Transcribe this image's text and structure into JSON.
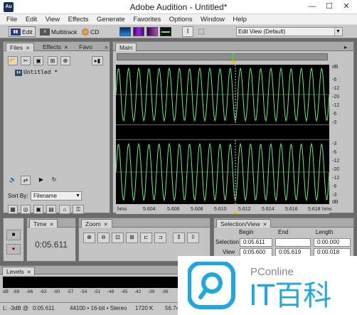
{
  "window": {
    "title": "Adobe Audition - Untitled*",
    "app_icon_label": "Au",
    "minimize": "—",
    "maximize": "☐",
    "close": "✕"
  },
  "menu": [
    "File",
    "Edit",
    "View",
    "Effects",
    "Generate",
    "Favorites",
    "Options",
    "Window",
    "Help"
  ],
  "toolbar": {
    "modes": [
      {
        "label": "Edit",
        "icon": "edit-view-icon"
      },
      {
        "label": "Multitrack",
        "icon": "multitrack-icon"
      },
      {
        "label": "CD",
        "icon": "cd-icon"
      }
    ],
    "view_select": "Edit View (Default)"
  },
  "files_panel": {
    "tabs": [
      "Files",
      "Effects",
      "Favo"
    ],
    "file_item": "Untitled *",
    "sort_label": "Sort By:",
    "sort_value": "Filename"
  },
  "main_panel": {
    "tab": "Main",
    "db_labels": [
      "dB",
      "-6",
      "-12",
      "-20",
      "-12",
      "-6",
      "-3"
    ],
    "db_labels_bottom": [
      "-3",
      "-6",
      "-12",
      "-20",
      "-12",
      "-6",
      "-3"
    ],
    "db_bottom_unit": "dB",
    "time_unit": "hms",
    "time_ticks": [
      "5.604",
      "5.606",
      "5.608",
      "5.610",
      "5.612",
      "5.614",
      "5.616",
      "5.618"
    ],
    "time_unit_end": "hms"
  },
  "time_panel": {
    "tab": "Time",
    "value": "0:05.611"
  },
  "zoom_panel": {
    "tab": "Zoom"
  },
  "selection_panel": {
    "tab": "Selection/View",
    "headers": [
      "Begin",
      "End",
      "Length"
    ],
    "rows": [
      {
        "label": "Selection",
        "begin": "0:05.611",
        "end": "",
        "length": "0:00.000"
      },
      {
        "label": "View",
        "begin": "0:05.600",
        "end": "0:05.619",
        "length": "0:00.018"
      }
    ]
  },
  "levels_panel": {
    "tab": "Levels",
    "scale": [
      "dB",
      "-69",
      "-66",
      "-63",
      "-60",
      "-57",
      "-54",
      "-51",
      "-48",
      "-45",
      "-42",
      "-39",
      "-36"
    ]
  },
  "status": {
    "db": "L: -3dB @",
    "time": "0:05.611",
    "format": "44100 • 16-bit • Stereo",
    "size": "1720 K",
    "disk": "56.74 GB"
  },
  "watermark": {
    "brand": "PConline",
    "text": "IT百科"
  },
  "colors": {
    "waveform": "#5ff07a",
    "accent": "#2b3f75",
    "cursor": "#f1c400"
  }
}
